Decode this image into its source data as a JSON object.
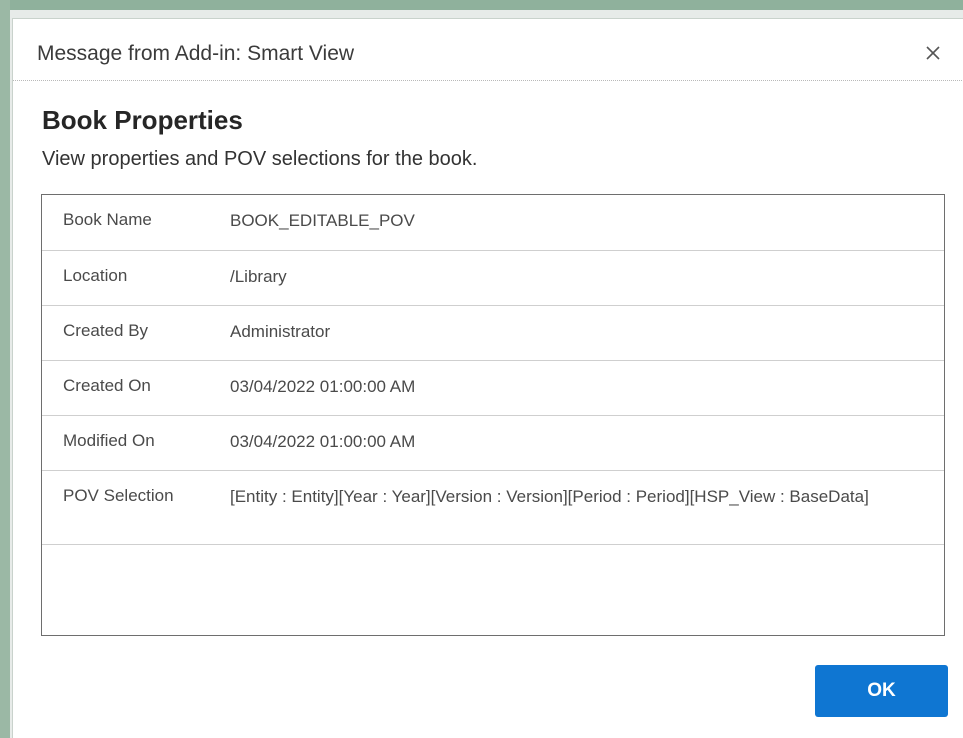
{
  "window": {
    "title": "Message from Add-in: Smart View",
    "close_icon": "close-icon"
  },
  "content": {
    "heading": "Book Properties",
    "description": "View properties and POV selections for the book."
  },
  "properties": [
    {
      "label": "Book Name",
      "value": "BOOK_EDITABLE_POV"
    },
    {
      "label": "Location",
      "value": "/Library"
    },
    {
      "label": "Created By",
      "value": "Administrator"
    },
    {
      "label": "Created On",
      "value": "03/04/2022 01:00:00 AM"
    },
    {
      "label": "Modified On",
      "value": "03/04/2022 01:00:00 AM"
    },
    {
      "label": "POV Selection",
      "value": "[Entity : Entity][Year : Year][Version : Version][Period : Period][HSP_View : BaseData]"
    }
  ],
  "footer": {
    "ok_label": "OK"
  },
  "colors": {
    "accent": "#0f76d2",
    "backdrop_accent": "#8fb19c"
  }
}
